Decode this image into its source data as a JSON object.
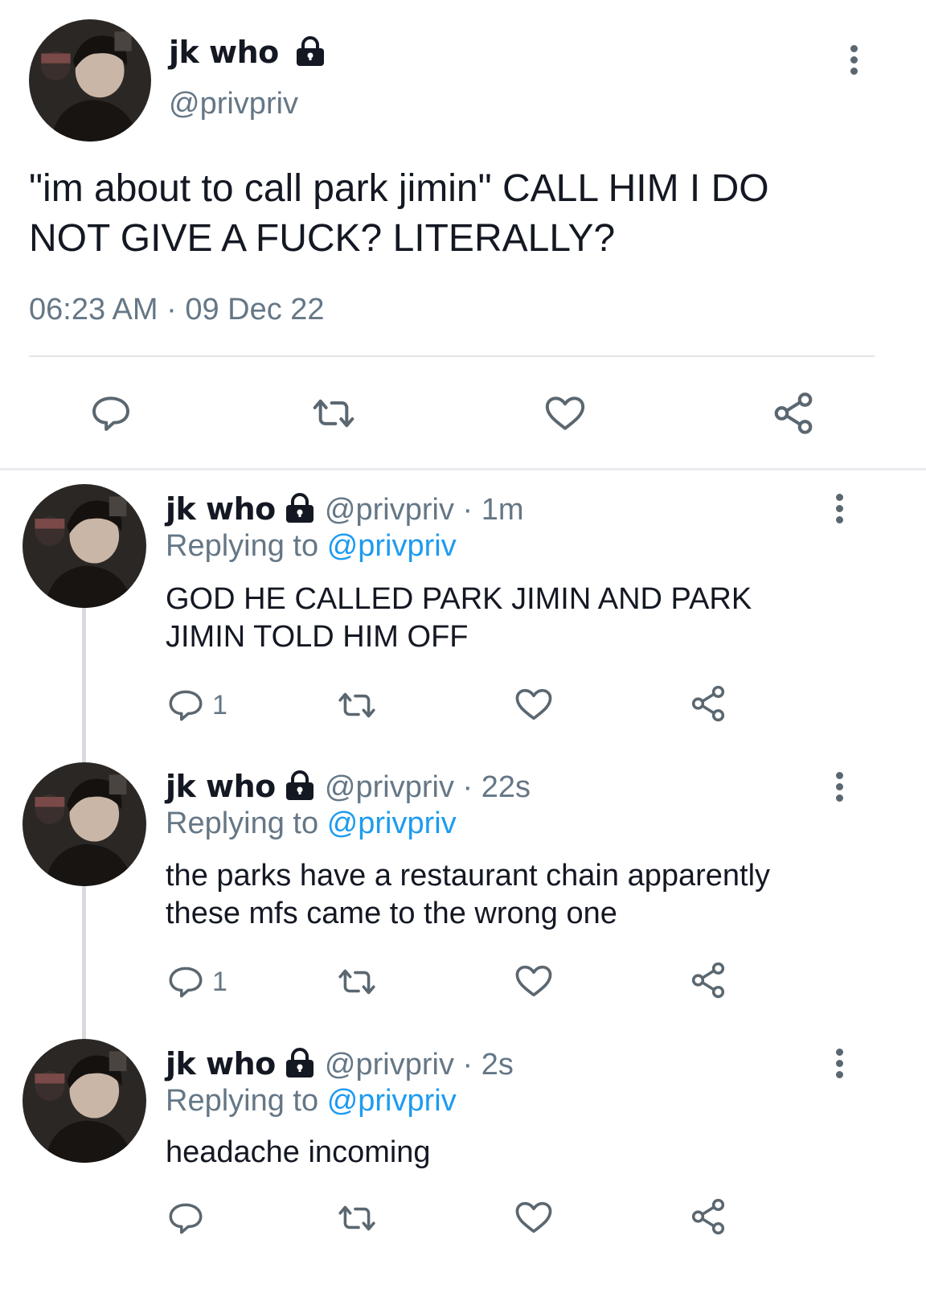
{
  "main_tweet": {
    "display_name": "jk who",
    "handle": "@privpriv",
    "text_line1": "\"im about to call park jimin\" CALL HIM I DO",
    "text_line2": "NOT GIVE A FUCK? LITERALLY?",
    "time": "06:23 AM",
    "separator": "·",
    "date": "09 Dec 22"
  },
  "replies": [
    {
      "display_name": "jk who",
      "handle": "@privpriv",
      "separator": "·",
      "age": "1m",
      "replying_prefix": "Replying to",
      "replying_handle": "@privpriv",
      "text_line1": "GOD HE CALLED PARK JIMIN AND PARK",
      "text_line2": "JIMIN TOLD HIM OFF",
      "reply_count": "1"
    },
    {
      "display_name": "jk who",
      "handle": "@privpriv",
      "separator": "·",
      "age": "22s",
      "replying_prefix": "Replying to",
      "replying_handle": "@privpriv",
      "text_line1": "the parks have a restaurant chain apparently",
      "text_line2": "these mfs came to the wrong one",
      "reply_count": "1"
    },
    {
      "display_name": "jk who",
      "handle": "@privpriv",
      "separator": "·",
      "age": "2s",
      "replying_prefix": "Replying to",
      "replying_handle": "@privpriv",
      "text_line1": "headache incoming",
      "reply_count": ""
    }
  ],
  "icons": {
    "lock": "lock-icon",
    "more": "more-vertical-icon",
    "reply": "reply-icon",
    "retweet": "retweet-icon",
    "like": "heart-icon",
    "share": "share-icon"
  },
  "colors": {
    "text": "#141823",
    "secondary": "#657786",
    "link": "#1d9bf0",
    "divider": "#e1e5e8"
  }
}
